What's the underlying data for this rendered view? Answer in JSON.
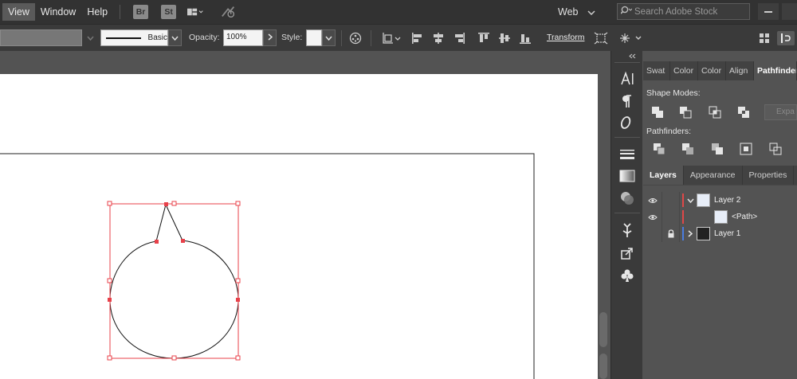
{
  "menubar": {
    "items": [
      "View",
      "Window",
      "Help"
    ],
    "bridge_badge": "Br",
    "stock_badge": "St",
    "workspace": "Web",
    "search_placeholder": "Search Adobe Stock"
  },
  "controlbar": {
    "stroke_style_label": "Basic",
    "opacity_label": "Opacity:",
    "opacity_value": "100%",
    "style_label": "Style:",
    "transform_label": "Transform"
  },
  "pathfinder_panel": {
    "tabs": [
      "Swat",
      "Color",
      "Color",
      "Align",
      "Pathfinder"
    ],
    "shape_modes_label": "Shape Modes:",
    "pathfinders_label": "Pathfinders:",
    "expand_label": "Expa"
  },
  "layers_panel": {
    "tabs": [
      "Layers",
      "Appearance",
      "Properties"
    ],
    "rows": [
      {
        "name": "Layer 2",
        "color": "#e04848"
      },
      {
        "name": "<Path>",
        "color": "#e04848"
      },
      {
        "name": "Layer 1",
        "color": "#4a7de0"
      }
    ]
  },
  "colors": {
    "selection": "#e8414a",
    "path": "#111111"
  }
}
